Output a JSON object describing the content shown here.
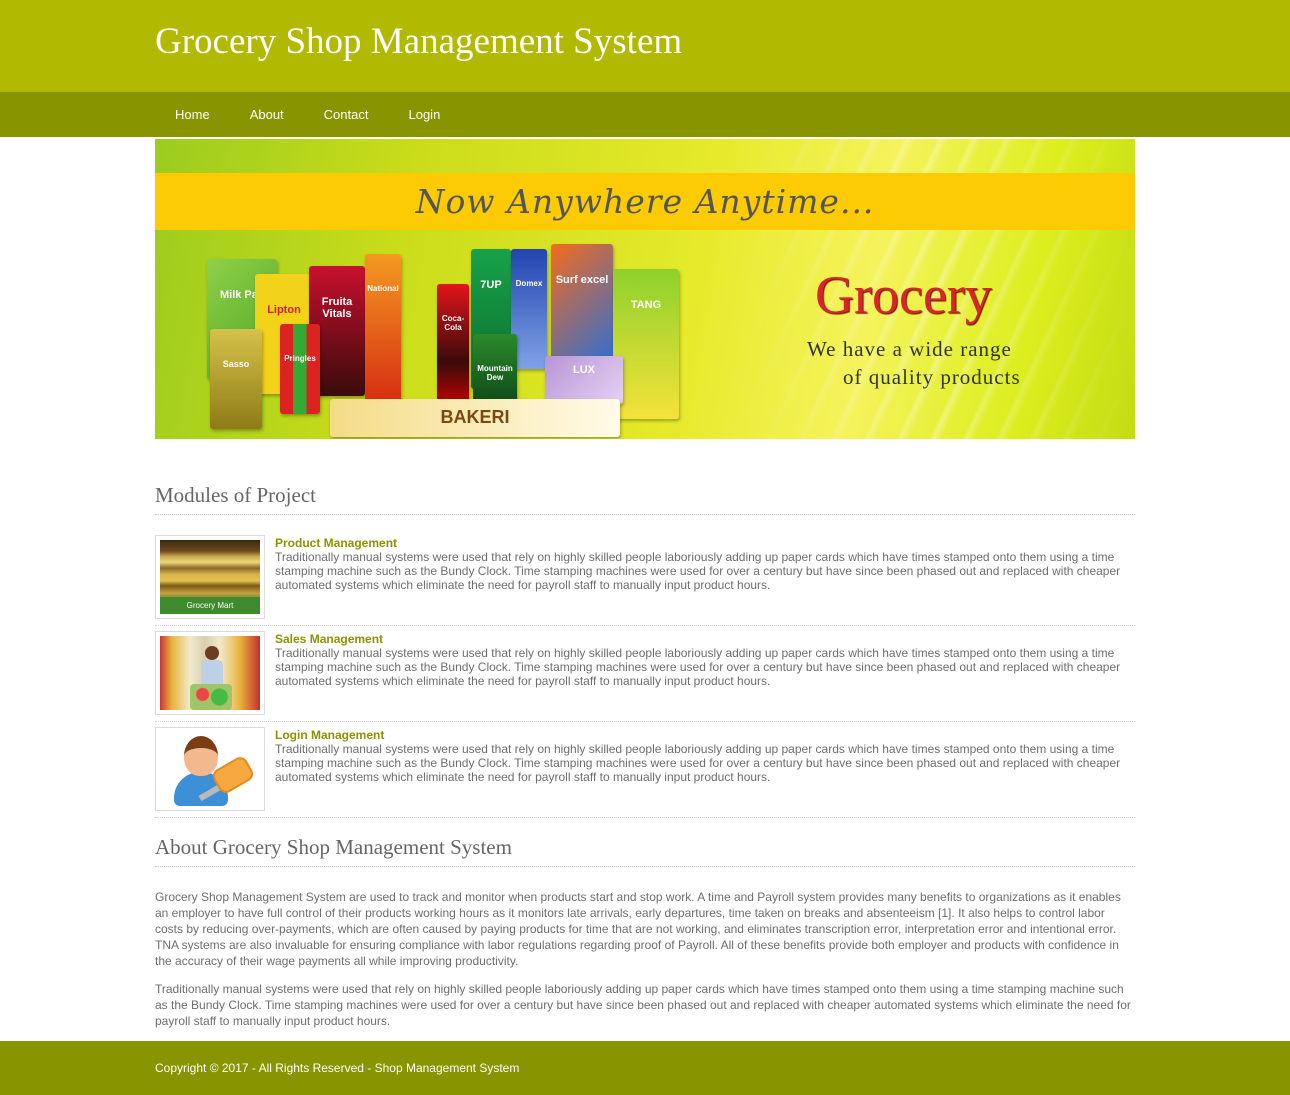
{
  "header": {
    "title": "Grocery Shop Management System"
  },
  "nav": {
    "items": [
      {
        "label": "Home"
      },
      {
        "label": "About"
      },
      {
        "label": "Contact"
      },
      {
        "label": "Login"
      }
    ]
  },
  "banner": {
    "tagline": "Now Anywhere Anytime...",
    "brand": "Grocery",
    "subtitle_line1": "We have a wide range",
    "subtitle_line2": "of quality products",
    "products": [
      "Milk Pak",
      "Lipton",
      "Fruita Vitals",
      "National",
      "Coca-Cola",
      "7UP",
      "Domex",
      "Surf excel",
      "TANG",
      "Sasso",
      "Pringles",
      "Mountain Dew",
      "LUX",
      "BAKERI"
    ]
  },
  "modules": {
    "title": "Modules of Project",
    "items": [
      {
        "title": "Product Management",
        "image_caption": "Grocery Mart",
        "text": "Traditionally manual systems were used that rely on highly skilled people laboriously adding up paper cards which have times stamped onto them using a time stamping machine such as the Bundy Clock. Time stamping machines were used for over a century but have since been phased out and replaced with cheaper automated systems which eliminate the need for payroll staff to manually input product hours."
      },
      {
        "title": "Sales Management",
        "text": "Traditionally manual systems were used that rely on highly skilled people laboriously adding up paper cards which have times stamped onto them using a time stamping machine such as the Bundy Clock. Time stamping machines were used for over a century but have since been phased out and replaced with cheaper automated systems which eliminate the need for payroll staff to manually input product hours."
      },
      {
        "title": "Login Management",
        "text": "Traditionally manual systems were used that rely on highly skilled people laboriously adding up paper cards which have times stamped onto them using a time stamping machine such as the Bundy Clock. Time stamping machines were used for over a century but have since been phased out and replaced with cheaper automated systems which eliminate the need for payroll staff to manually input product hours."
      }
    ]
  },
  "about": {
    "title": "About Grocery Shop Management System",
    "paragraphs": [
      "Grocery Shop Management System are used to track and monitor when products start and stop work. A time and Payroll system provides many benefits to organizations as it enables an employer to have full control of their products working hours as it monitors late arrivals, early departures, time taken on breaks and absenteeism [1]. It also helps to control labor costs by reducing over-payments, which are often caused by paying products for time that are not working, and eliminates transcription error, interpretation error and intentional error. TNA systems are also invaluable for ensuring compliance with labor regulations regarding proof of Payroll. All of these benefits provide both employer and products with confidence in the accuracy of their wage payments all while improving productivity.",
      "Traditionally manual systems were used that rely on highly skilled people laboriously adding up paper cards which have times stamped onto them using a time stamping machine such as the Bundy Clock. Time stamping machines were used for over a century but have since been phased out and replaced with cheaper automated systems which eliminate the need for payroll staff to manually input product hours."
    ]
  },
  "footer": {
    "copyright": "Copyright © 2017 - All Rights Reserved - Shop Management System"
  },
  "colors": {
    "header_bg": "#b1ba00",
    "nav_bg": "#889400",
    "accent": "#889400",
    "banner_ribbon": "#fccb03",
    "brand_red": "#d6262a"
  }
}
